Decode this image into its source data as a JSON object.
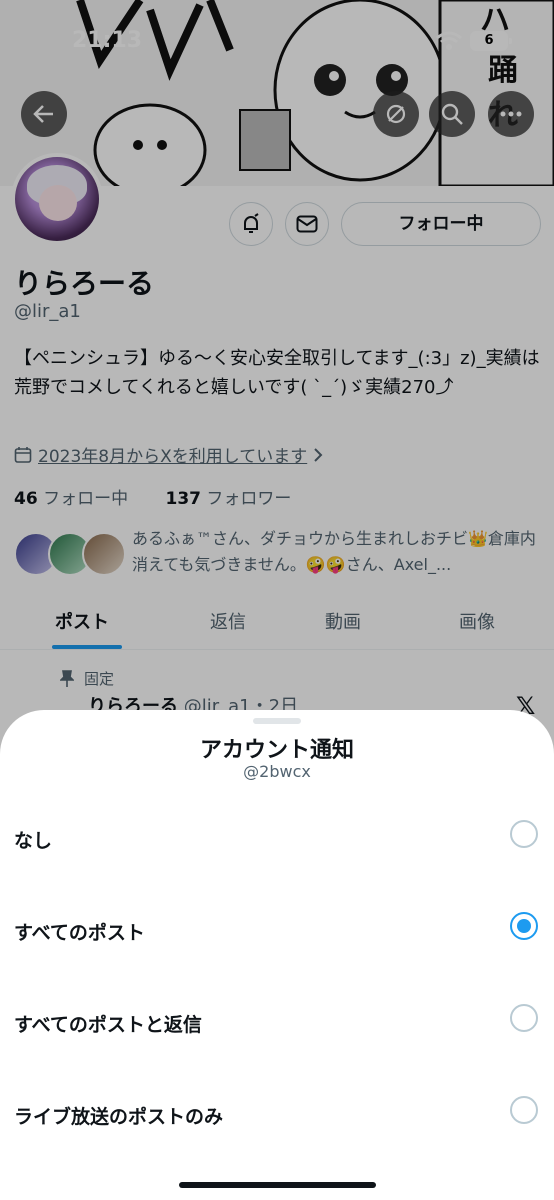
{
  "status_bar": {
    "time": "21:13",
    "battery": "6"
  },
  "profile": {
    "display_name": "りらろーる",
    "handle": "@lir_a1",
    "follow_button": "フォロー中",
    "bio": "【ペニンシュラ】ゆる～く安心安全取引してます_(:3」z)_実績は荒野でコメしてくれると嬉しいです( ˋ_ˊ)ゞ実績270⤴︎",
    "joined": "2023年8月からXを利用しています",
    "following_count": "46",
    "following_label": "フォロー中",
    "followers_count": "137",
    "followers_label": "フォロワー",
    "known_followers": "あるふぁ™さん、ダチョウから生まれしおチビ👑倉庫内消えても気づきません。🤪🤪さん、Axel_..."
  },
  "tabs": [
    "ポスト",
    "返信",
    "動画",
    "画像"
  ],
  "post": {
    "pinned_label": "固定",
    "author": "りらろーる",
    "meta": "@lir_a1・2日"
  },
  "sheet": {
    "title": "アカウント通知",
    "subtitle": "@2bwcx",
    "options": [
      {
        "label": "なし",
        "selected": false
      },
      {
        "label": "すべてのポスト",
        "selected": true
      },
      {
        "label": "すべてのポストと返信",
        "selected": false
      },
      {
        "label": "ライブ放送のポストのみ",
        "selected": false
      }
    ]
  },
  "colors": {
    "accent": "#1d9bf0",
    "text": "#0f1419",
    "secondary": "#536471"
  },
  "icons": [
    "back-arrow-icon",
    "refresh-icon",
    "search-icon",
    "more-icon",
    "bell-icon",
    "mail-icon",
    "calendar-icon",
    "chevron-right-icon",
    "pin-icon",
    "x-logo-icon"
  ]
}
